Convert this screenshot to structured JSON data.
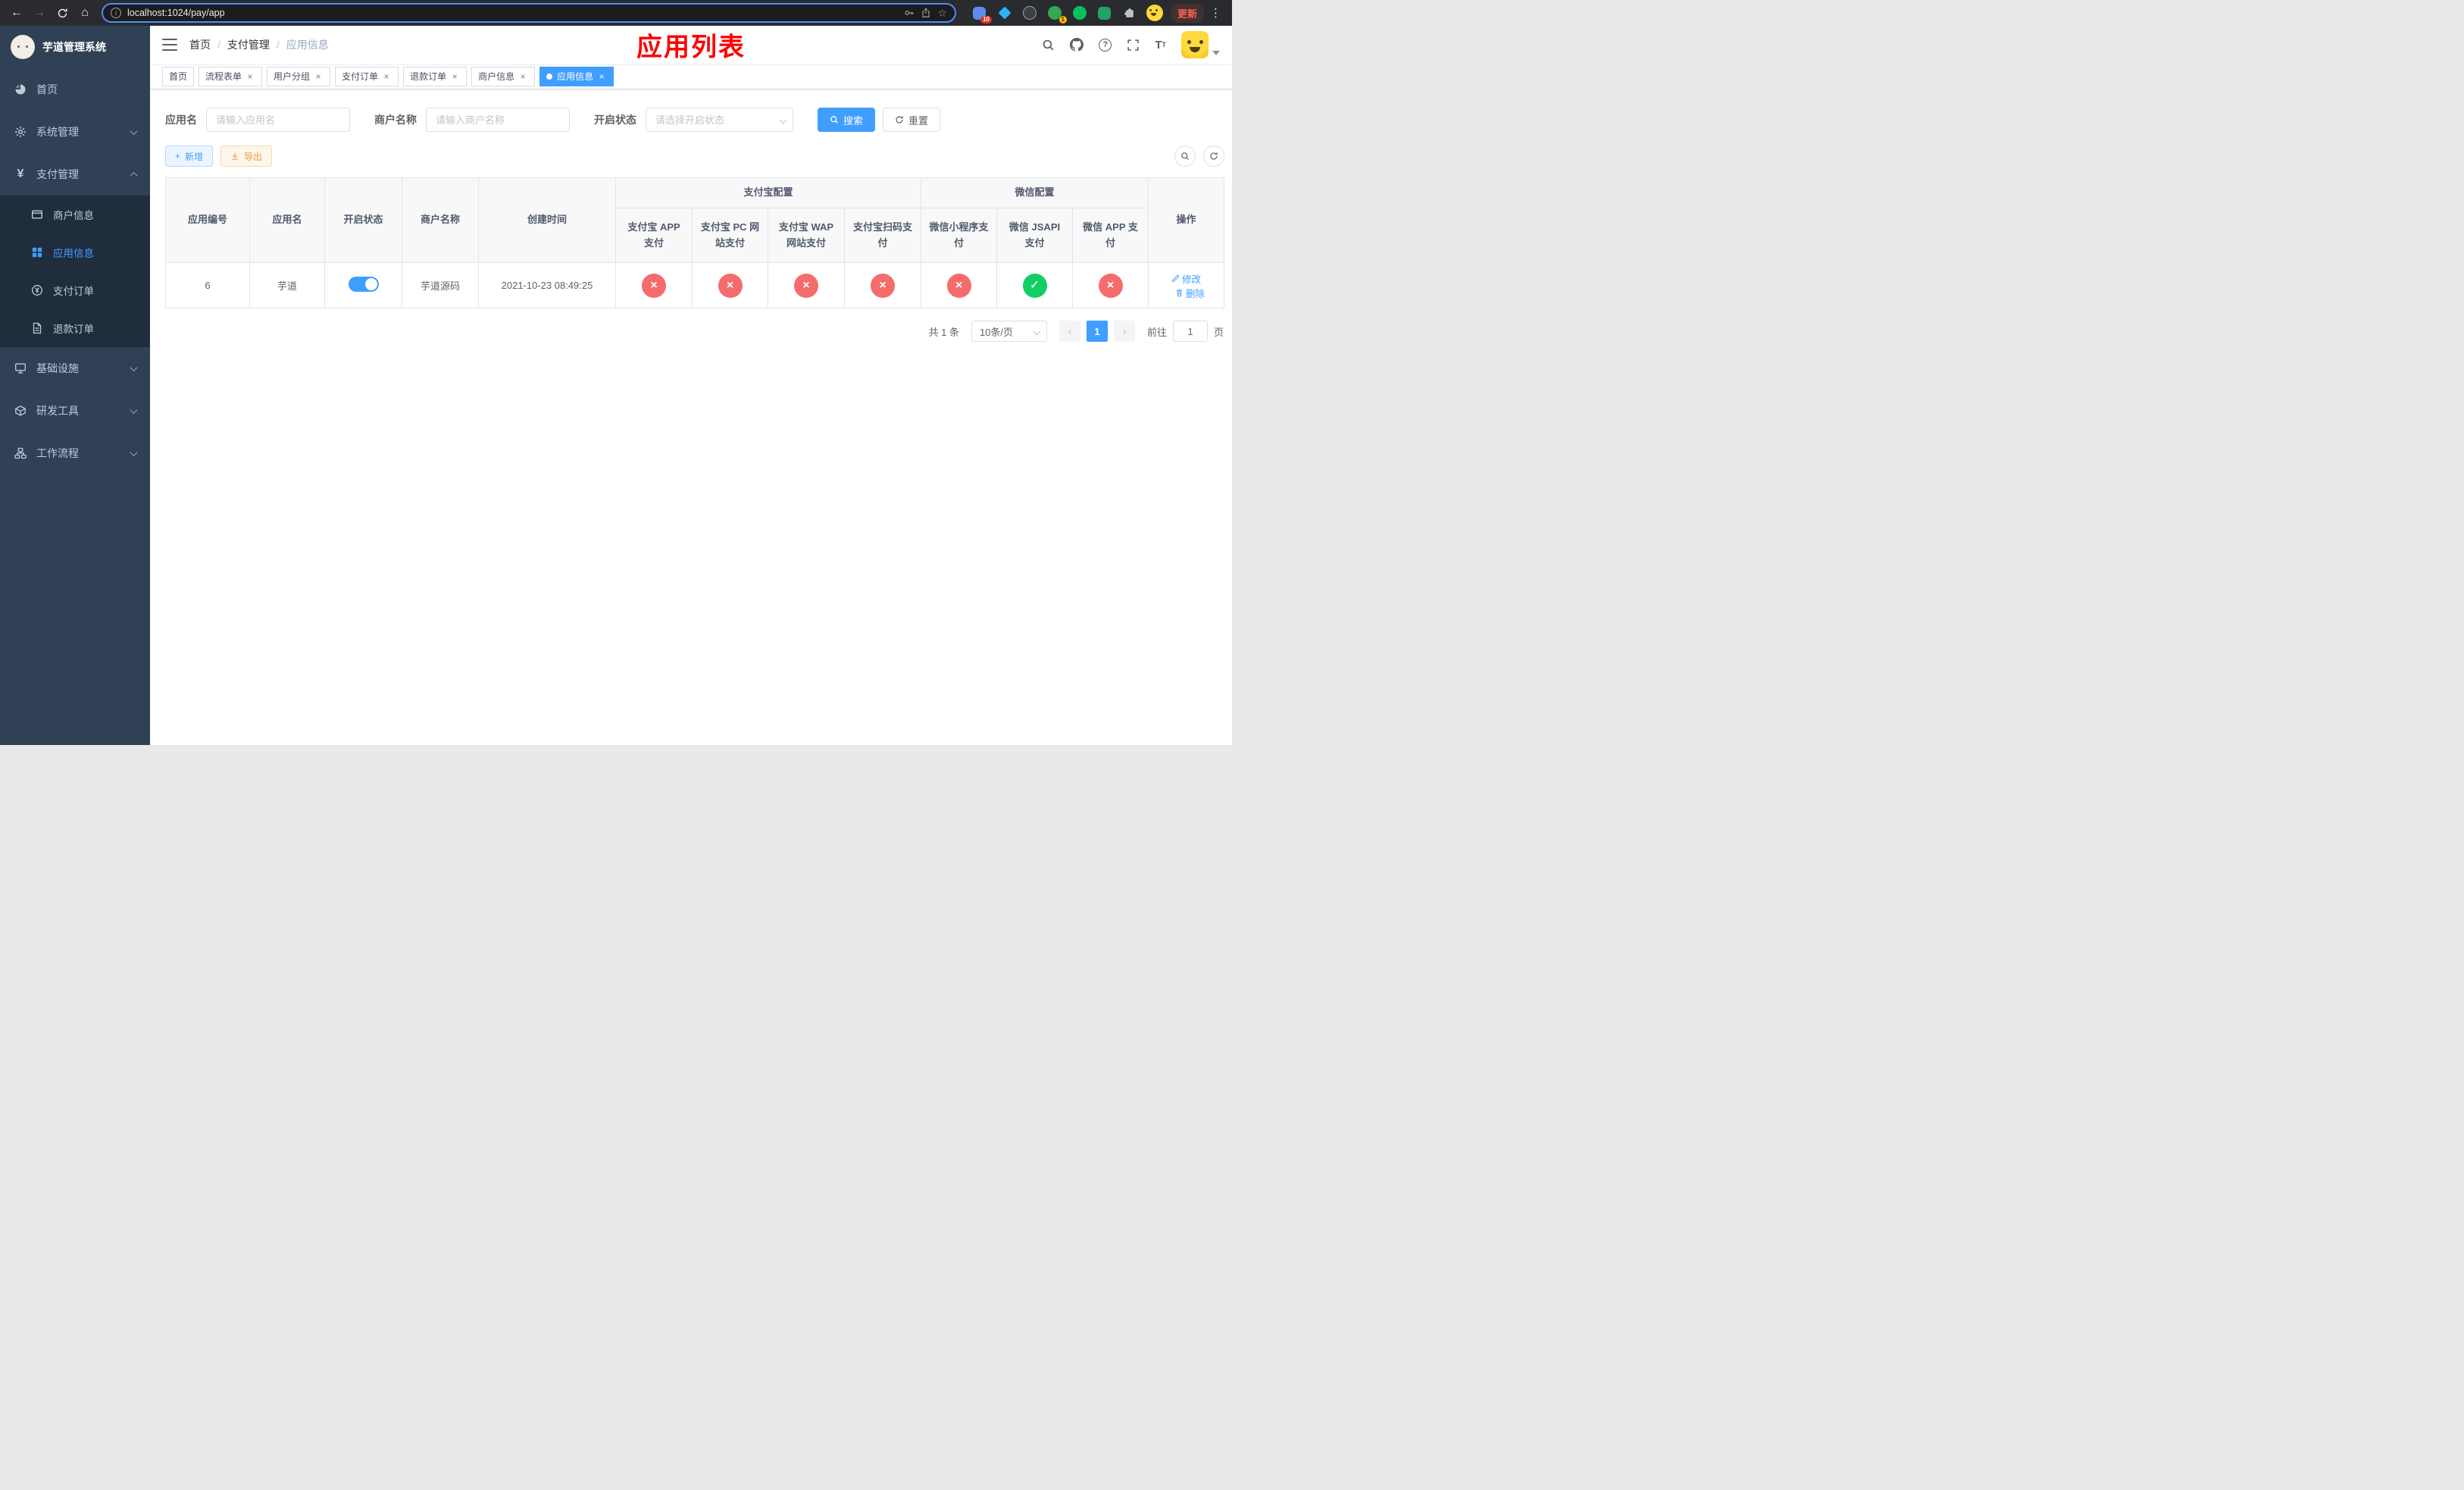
{
  "colors": {
    "accent": "#409eff",
    "success": "#13ce66",
    "danger": "#f56c6c",
    "warning": "#e6a23c",
    "sidebar_bg": "#304156",
    "annotation_red": "#fe0000"
  },
  "browser": {
    "url": "localhost:1024/pay/app",
    "update_label": "更新",
    "ext_badge_1": "10",
    "ext_badge_2": "1"
  },
  "sidebar": {
    "logo_title": "芋道管理系统",
    "items": [
      {
        "label": "首页"
      },
      {
        "label": "系统管理"
      },
      {
        "label": "支付管理"
      },
      {
        "label": "基础设施"
      },
      {
        "label": "研发工具"
      },
      {
        "label": "工作流程"
      }
    ],
    "pay_submenu": [
      {
        "label": "商户信息"
      },
      {
        "label": "应用信息"
      },
      {
        "label": "支付订单"
      },
      {
        "label": "退款订单"
      }
    ]
  },
  "breadcrumb": {
    "items": [
      "首页",
      "支付管理",
      "应用信息"
    ]
  },
  "annotation": "应用列表",
  "tabs": [
    {
      "label": "首页"
    },
    {
      "label": "流程表单"
    },
    {
      "label": "用户分组"
    },
    {
      "label": "支付订单"
    },
    {
      "label": "退款订单"
    },
    {
      "label": "商户信息"
    },
    {
      "label": "应用信息"
    }
  ],
  "active_tab_index": 6,
  "filters": {
    "app_name_label": "应用名",
    "app_name_placeholder": "请输入应用名",
    "merchant_label": "商户名称",
    "merchant_placeholder": "请输入商户名称",
    "status_label": "开启状态",
    "status_placeholder": "请选择开启状态",
    "search_label": "搜索",
    "reset_label": "重置"
  },
  "toolbar": {
    "add_label": "新增",
    "export_label": "导出"
  },
  "table": {
    "headers": {
      "app_id": "应用编号",
      "app_name": "应用名",
      "status": "开启状态",
      "merchant_name": "商户名称",
      "create_time": "创建时间",
      "alipay_group": "支付宝配置",
      "alipay_app": "支付宝 APP 支付",
      "alipay_pc": "支付宝 PC 网站支付",
      "alipay_wap": "支付宝 WAP 网站支付",
      "alipay_qr": "支付宝扫码支付",
      "wechat_group": "微信配置",
      "wechat_mini": "微信小程序支付",
      "wechat_jsapi": "微信 JSAPI 支付",
      "wechat_app": "微信 APP 支付",
      "actions": "操作"
    },
    "rows": [
      {
        "app_id": "6",
        "app_name": "芋道",
        "status_on": true,
        "merchant_name": "芋道源码",
        "create_time": "2021-10-23 08:49:25",
        "configs": [
          "disabled",
          "disabled",
          "disabled",
          "disabled",
          "disabled",
          "enabled",
          "disabled"
        ],
        "edit_label": "修改",
        "delete_label": "删除"
      }
    ]
  },
  "pagination": {
    "total_label": "共 1 条",
    "page_size_label": "10条/页",
    "current_page": "1",
    "goto_prefix": "前往",
    "goto_value": "1",
    "goto_suffix": "页"
  }
}
